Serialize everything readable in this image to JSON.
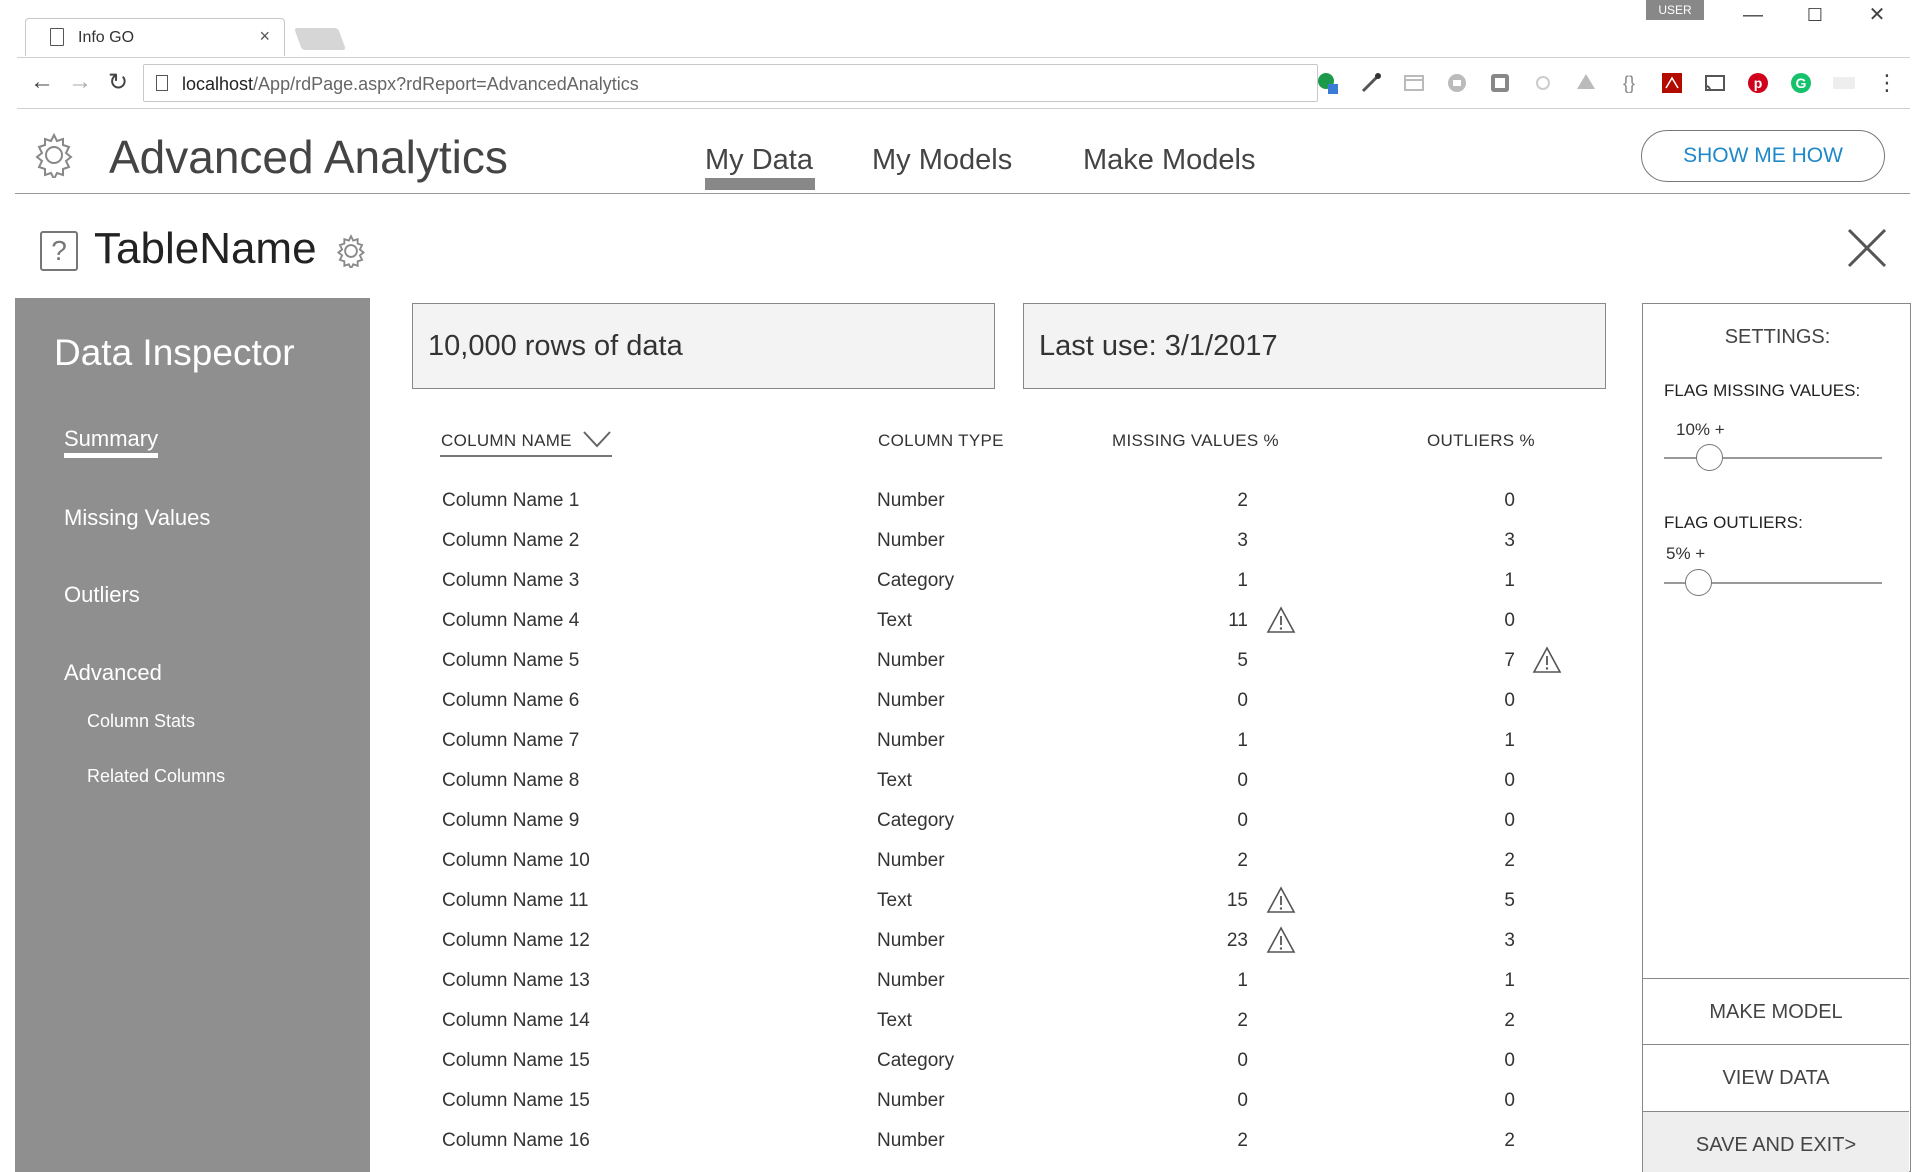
{
  "browser": {
    "tab_title": "Info GO",
    "tab_close": "×",
    "user_badge": "USER",
    "url_host": "localhost",
    "url_path": "/App/rdPage.aspx?rdReport=AdvancedAnalytics",
    "window_controls": [
      "—",
      "☐",
      "✕"
    ],
    "extensions": [
      "green-badge-icon",
      "eyedropper-icon",
      "layout-icon",
      "circle-icon",
      "square-icon",
      "dot-icon",
      "drive-icon",
      "braces-icon",
      "pdf-icon",
      "cast-icon",
      "pinterest-icon",
      "grammarly-icon",
      "fonts-icon",
      "menu-icon"
    ]
  },
  "app": {
    "title": "Advanced Analytics",
    "tabs": [
      "My Data",
      "My Models",
      "Make Models"
    ],
    "active_tab": "My Data",
    "show_me_how": "SHOW ME HOW"
  },
  "subheader": {
    "help": "?",
    "table_name": "TableName"
  },
  "sidebar": {
    "title": "Data Inspector",
    "items": [
      "Summary",
      "Missing Values",
      "Outliers",
      "Advanced"
    ],
    "subitems": [
      "Column Stats",
      "Related Columns"
    ],
    "active": "Summary"
  },
  "stats": {
    "rows": "10,000 rows of data",
    "last_use": "Last use: 3/1/2017"
  },
  "table": {
    "headers": [
      "COLUMN NAME",
      "COLUMN TYPE",
      "MISSING VALUES %",
      "OUTLIERS %"
    ],
    "rows": [
      {
        "name": "Column Name 1",
        "type": "Number",
        "missing": "2",
        "outliers": "0",
        "warn_missing": false,
        "warn_outliers": false
      },
      {
        "name": "Column Name 2",
        "type": "Number",
        "missing": "3",
        "outliers": "3",
        "warn_missing": false,
        "warn_outliers": false
      },
      {
        "name": "Column Name 3",
        "type": "Category",
        "missing": "1",
        "outliers": "1",
        "warn_missing": false,
        "warn_outliers": false
      },
      {
        "name": "Column Name 4",
        "type": "Text",
        "missing": "11",
        "outliers": "0",
        "warn_missing": true,
        "warn_outliers": false
      },
      {
        "name": "Column Name 5",
        "type": "Number",
        "missing": "5",
        "outliers": "7",
        "warn_missing": false,
        "warn_outliers": true
      },
      {
        "name": "Column Name 6",
        "type": "Number",
        "missing": "0",
        "outliers": "0",
        "warn_missing": false,
        "warn_outliers": false
      },
      {
        "name": "Column Name 7",
        "type": "Number",
        "missing": "1",
        "outliers": "1",
        "warn_missing": false,
        "warn_outliers": false
      },
      {
        "name": "Column Name 8",
        "type": "Text",
        "missing": "0",
        "outliers": "0",
        "warn_missing": false,
        "warn_outliers": false
      },
      {
        "name": "Column Name 9",
        "type": "Category",
        "missing": "0",
        "outliers": "0",
        "warn_missing": false,
        "warn_outliers": false
      },
      {
        "name": "Column Name 10",
        "type": "Number",
        "missing": "2",
        "outliers": "2",
        "warn_missing": false,
        "warn_outliers": false
      },
      {
        "name": "Column Name 11",
        "type": "Text",
        "missing": "15",
        "outliers": "5",
        "warn_missing": true,
        "warn_outliers": false
      },
      {
        "name": "Column Name 12",
        "type": "Number",
        "missing": "23",
        "outliers": "3",
        "warn_missing": true,
        "warn_outliers": false
      },
      {
        "name": "Column Name 13",
        "type": "Number",
        "missing": "1",
        "outliers": "1",
        "warn_missing": false,
        "warn_outliers": false
      },
      {
        "name": "Column Name 14",
        "type": "Text",
        "missing": "2",
        "outliers": "2",
        "warn_missing": false,
        "warn_outliers": false
      },
      {
        "name": "Column Name 15",
        "type": "Category",
        "missing": "0",
        "outliers": "0",
        "warn_missing": false,
        "warn_outliers": false
      },
      {
        "name": "Column Name 15",
        "type": "Number",
        "missing": "0",
        "outliers": "0",
        "warn_missing": false,
        "warn_outliers": false
      },
      {
        "name": "Column Name 16",
        "type": "Number",
        "missing": "2",
        "outliers": "2",
        "warn_missing": false,
        "warn_outliers": false
      }
    ]
  },
  "settings": {
    "title": "SETTINGS:",
    "missing_label": "FLAG MISSING VALUES:",
    "missing_value": "10% +",
    "missing_level": 0.15,
    "outliers_label": "FLAG OUTLIERS:",
    "outliers_value": "5% +",
    "outliers_level": 0.1,
    "buttons": [
      "MAKE MODEL",
      "VIEW DATA",
      "SAVE AND EXIT>"
    ]
  }
}
